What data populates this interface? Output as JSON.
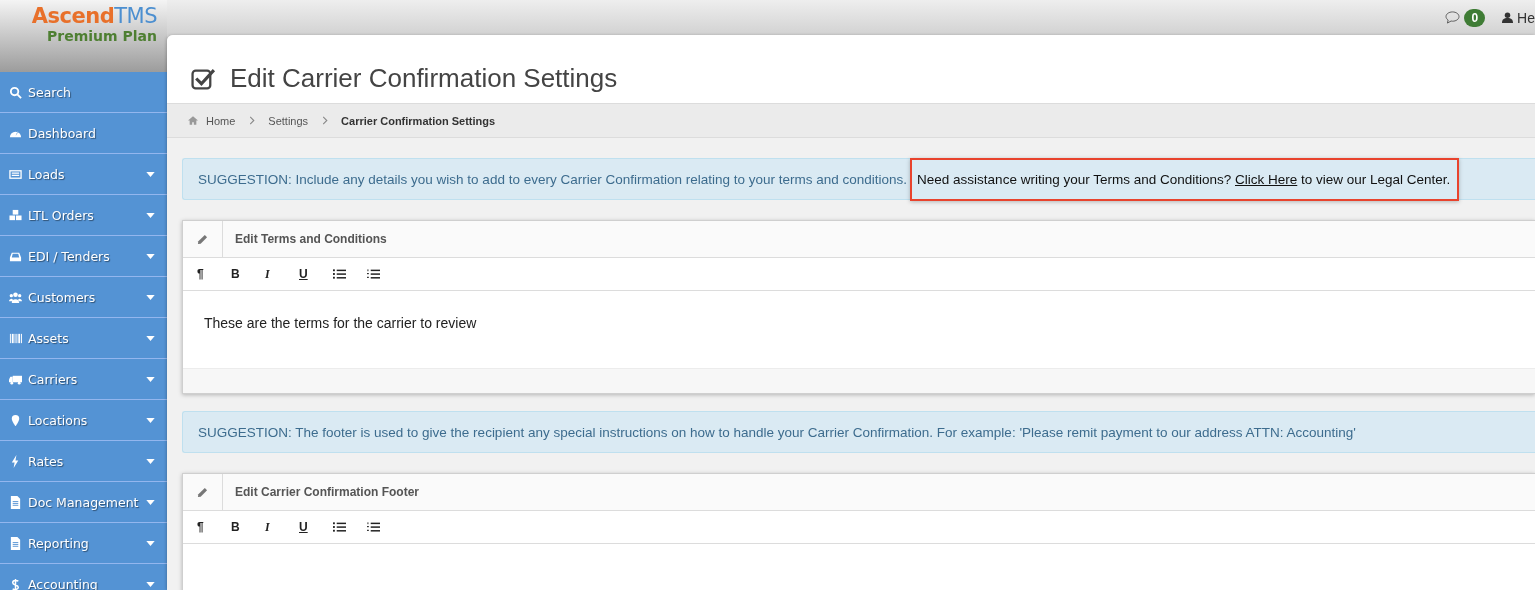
{
  "logo": {
    "brand_primary": "Ascend",
    "brand_secondary": "TMS",
    "plan": "Premium Plan"
  },
  "topbar": {
    "message_count": "0",
    "user_name": "He"
  },
  "sidebar": {
    "items": [
      {
        "label": "Search",
        "expandable": false
      },
      {
        "label": "Dashboard",
        "expandable": false
      },
      {
        "label": "Loads",
        "expandable": true
      },
      {
        "label": "LTL Orders",
        "expandable": true
      },
      {
        "label": "EDI / Tenders",
        "expandable": true
      },
      {
        "label": "Customers",
        "expandable": true
      },
      {
        "label": "Assets",
        "expandable": true
      },
      {
        "label": "Carriers",
        "expandable": true
      },
      {
        "label": "Locations",
        "expandable": true
      },
      {
        "label": "Rates",
        "expandable": true
      },
      {
        "label": "Doc Management",
        "expandable": true
      },
      {
        "label": "Reporting",
        "expandable": true
      },
      {
        "label": "Accounting",
        "expandable": true
      }
    ]
  },
  "page_title": "Edit Carrier Confirmation Settings",
  "breadcrumb": [
    {
      "label": "Home",
      "current": false
    },
    {
      "label": "Settings",
      "current": false
    },
    {
      "label": "Carrier Confirmation Settings",
      "current": true
    }
  ],
  "sections": [
    {
      "suggestion": "SUGGESTION: Include any details you wish to add to every Carrier Confirmation relating to your terms and conditions.",
      "callout": {
        "before": "Need assistance writing your Terms and Conditions?",
        "link": "Click Here",
        "after": "to view our Legal Center."
      },
      "editor": {
        "title": "Edit Terms and Conditions",
        "content": "These are the terms for the carrier to review",
        "toolbar": [
          {
            "kind": "text",
            "label": "¶"
          },
          {
            "kind": "text",
            "label": "B"
          },
          {
            "kind": "text",
            "label": "I"
          },
          {
            "kind": "text",
            "label": "U"
          },
          {
            "kind": "bulleted-list"
          },
          {
            "kind": "numbered-list"
          }
        ]
      }
    },
    {
      "suggestion": "SUGGESTION: The footer is used to give the recipient any special instructions on how to handle your Carrier Confirmation. For example: 'Please remit payment to our address ATTN: Accounting'",
      "editor": {
        "title": "Edit Carrier Confirmation Footer",
        "toolbar": [
          {
            "kind": "text",
            "label": "¶"
          },
          {
            "kind": "text",
            "label": "B"
          },
          {
            "kind": "text",
            "label": "I"
          },
          {
            "kind": "text",
            "label": "U"
          },
          {
            "kind": "bulleted-list"
          },
          {
            "kind": "numbered-list"
          }
        ]
      }
    }
  ]
}
